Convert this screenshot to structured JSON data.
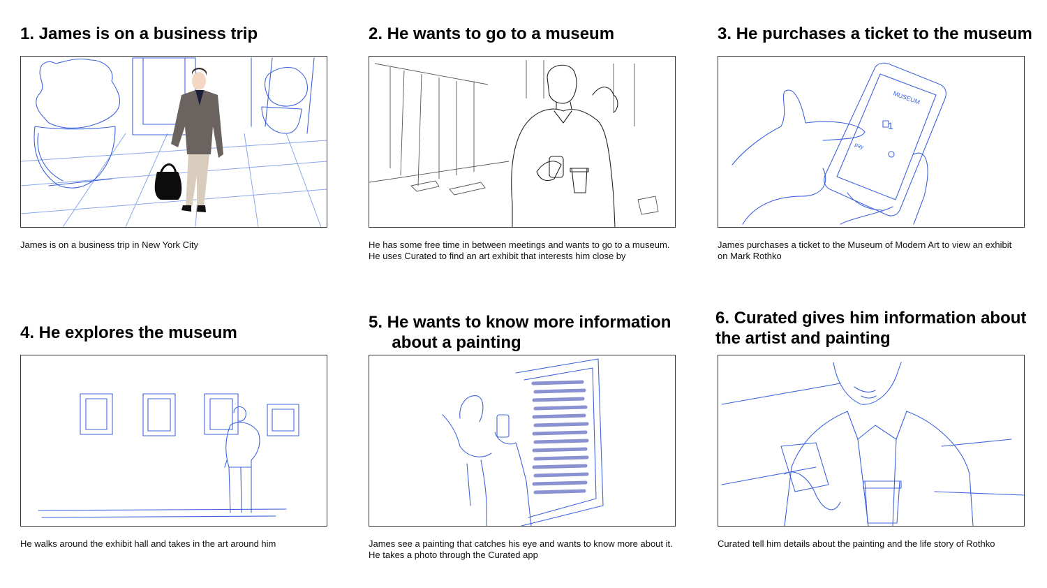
{
  "panels": [
    {
      "title": "1. James is on a business trip",
      "caption": "James is on a business trip in New York City",
      "illustration": "man-walking-with-bag-icon"
    },
    {
      "title": "2. He wants to go to a museum",
      "caption": "He has some free time in between meetings and wants to go to a museum.\nHe uses Curated to find an art exhibit that interests him close by",
      "illustration": "man-with-phone-and-coffee-icon"
    },
    {
      "title": "3. He purchases a ticket to the museum",
      "caption": "James purchases a ticket to the Museum of Modern Art to view an exhibit\non Mark Rothko",
      "illustration": "hand-holding-phone-icon",
      "phone_text": {
        "heading": "MUSEUM",
        "count": "1",
        "pay": "pay"
      }
    },
    {
      "title": "4. He explores the museum",
      "caption": "He walks around the exhibit hall and takes in the art around him",
      "illustration": "man-viewing-paintings-icon"
    },
    {
      "title": "5. He wants to know more information\n     about a painting",
      "caption": "James see a painting that catches his eye and wants to know more about it.\nHe takes a photo through the Curated app",
      "illustration": "man-photographing-painting-icon"
    },
    {
      "title": "6. Curated gives him information about\nthe artist and painting",
      "caption": "Curated tell him details about the painting and the life story of Rothko",
      "illustration": "man-reading-phone-icon"
    }
  ],
  "colors": {
    "sketch_blue": "#3f63dd",
    "sketch_ink": "#222222",
    "frame_border": "#333333",
    "suit": "#6b6360",
    "trousers": "#d8cdbd",
    "skin": "#f3d6c4"
  }
}
